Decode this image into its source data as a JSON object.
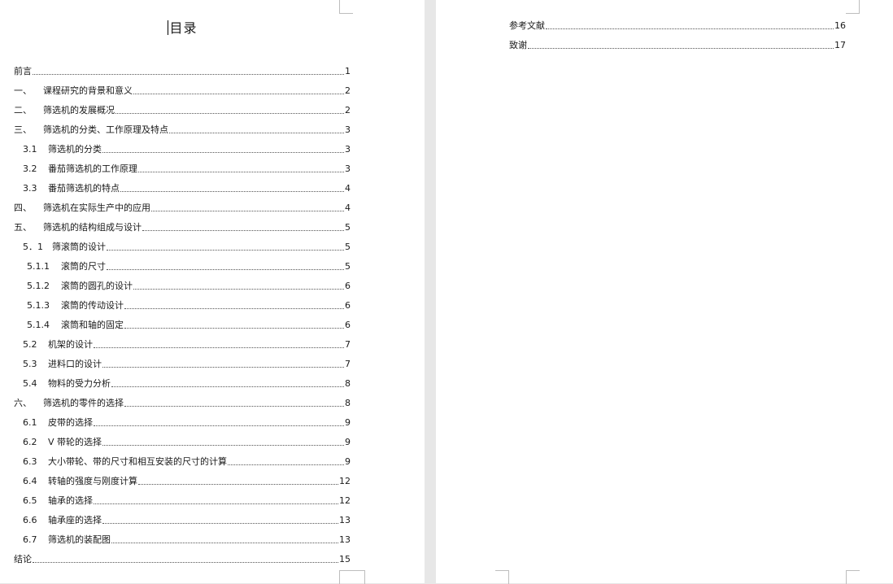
{
  "left_page": {
    "title": "目录",
    "entries": [
      {
        "num": "",
        "text": "前言",
        "page": "1"
      },
      {
        "num": "一、",
        "text": "课程研究的背景和意义",
        "page": "2"
      },
      {
        "num": "二、",
        "text": "筛选机的发展概况",
        "page": "2"
      },
      {
        "num": "三、",
        "text": "筛选机的分类、工作原理及特点",
        "page": "3"
      },
      {
        "num": "3.1",
        "text": "筛选机的分类",
        "page": "3"
      },
      {
        "num": "3.2",
        "text": "番茄筛选机的工作原理",
        "page": "3"
      },
      {
        "num": "3.3",
        "text": "番茄筛选机的特点",
        "page": "4"
      },
      {
        "num": "四、",
        "text": "筛选机在实际生产中的应用",
        "page": "4"
      },
      {
        "num": "五、",
        "text": "筛选机的结构组成与设计",
        "page": "5"
      },
      {
        "num": "5．1",
        "text": "筛滚筒的设计",
        "page": "5"
      },
      {
        "num": "5.1.1",
        "text": "滚筒的尺寸",
        "page": "5"
      },
      {
        "num": "5.1.2",
        "text": "滚筒的圆孔的设计",
        "page": "6"
      },
      {
        "num": "5.1.3",
        "text": "滚筒的传动设计",
        "page": "6"
      },
      {
        "num": "5.1.4",
        "text": "滚筒和轴的固定",
        "page": "6"
      },
      {
        "num": "5.2",
        "text": "机架的设计",
        "page": "7"
      },
      {
        "num": "5.3",
        "text": "进料口的设计",
        "page": "7"
      },
      {
        "num": "5.4",
        "text": "物料的受力分析",
        "page": "8"
      },
      {
        "num": "六、",
        "text": "筛选机的零件的选择",
        "page": "8"
      },
      {
        "num": "6.1",
        "text": "皮带的选择",
        "page": "9"
      },
      {
        "num": "6.2",
        "text": "V 带轮的选择",
        "page": "9"
      },
      {
        "num": "6.3",
        "text": "大小带轮、带的尺寸和相互安装的尺寸的计算",
        "page": "9"
      },
      {
        "num": "6.4",
        "text": "转轴的强度与刚度计算",
        "page": "12"
      },
      {
        "num": "6.5",
        "text": "轴承的选择",
        "page": "12"
      },
      {
        "num": "6.6",
        "text": "轴承座的选择",
        "page": "13"
      },
      {
        "num": "6.7",
        "text": "筛选机的装配图",
        "page": "13"
      },
      {
        "num": "",
        "text": "结论",
        "page": "15"
      }
    ]
  },
  "right_page": {
    "entries": [
      {
        "num": "",
        "text": "参考文献",
        "page": "16"
      },
      {
        "num": "",
        "text": "致谢",
        "page": "17"
      }
    ]
  }
}
